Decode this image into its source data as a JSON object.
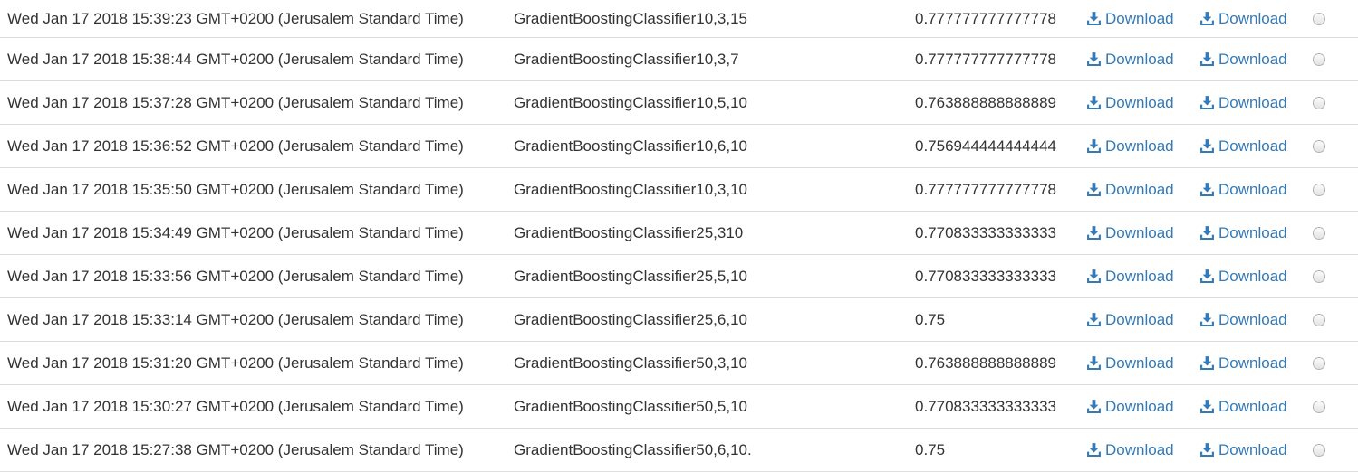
{
  "rows": [
    {
      "date": "Wed Jan 17 2018 15:39:23 GMT+0200 (Jerusalem Standard Time)",
      "model": "GradientBoostingClassifier10,3,15",
      "score": "0.777777777777778",
      "download_1": "Download",
      "download_2": "Download"
    },
    {
      "date": "Wed Jan 17 2018 15:38:44 GMT+0200 (Jerusalem Standard Time)",
      "model": "GradientBoostingClassifier10,3,7",
      "score": "0.777777777777778",
      "download_1": "Download",
      "download_2": "Download"
    },
    {
      "date": "Wed Jan 17 2018 15:37:28 GMT+0200 (Jerusalem Standard Time)",
      "model": "GradientBoostingClassifier10,5,10",
      "score": "0.763888888888889",
      "download_1": "Download",
      "download_2": "Download"
    },
    {
      "date": "Wed Jan 17 2018 15:36:52 GMT+0200 (Jerusalem Standard Time)",
      "model": "GradientBoostingClassifier10,6,10",
      "score": "0.756944444444444",
      "download_1": "Download",
      "download_2": "Download"
    },
    {
      "date": "Wed Jan 17 2018 15:35:50 GMT+0200 (Jerusalem Standard Time)",
      "model": "GradientBoostingClassifier10,3,10",
      "score": "0.777777777777778",
      "download_1": "Download",
      "download_2": "Download"
    },
    {
      "date": "Wed Jan 17 2018 15:34:49 GMT+0200 (Jerusalem Standard Time)",
      "model": "GradientBoostingClassifier25,310",
      "score": "0.770833333333333",
      "download_1": "Download",
      "download_2": "Download"
    },
    {
      "date": "Wed Jan 17 2018 15:33:56 GMT+0200 (Jerusalem Standard Time)",
      "model": "GradientBoostingClassifier25,5,10",
      "score": "0.770833333333333",
      "download_1": "Download",
      "download_2": "Download"
    },
    {
      "date": "Wed Jan 17 2018 15:33:14 GMT+0200 (Jerusalem Standard Time)",
      "model": "GradientBoostingClassifier25,6,10",
      "score": "0.75",
      "download_1": "Download",
      "download_2": "Download"
    },
    {
      "date": "Wed Jan 17 2018 15:31:20 GMT+0200 (Jerusalem Standard Time)",
      "model": "GradientBoostingClassifier50,3,10",
      "score": "0.763888888888889",
      "download_1": "Download",
      "download_2": "Download"
    },
    {
      "date": "Wed Jan 17 2018 15:30:27 GMT+0200 (Jerusalem Standard Time)",
      "model": "GradientBoostingClassifier50,5,10",
      "score": "0.770833333333333",
      "download_1": "Download",
      "download_2": "Download"
    },
    {
      "date": "Wed Jan 17 2018 15:27:38 GMT+0200 (Jerusalem Standard Time)",
      "model": "GradientBoostingClassifier50,6,10.",
      "score": "0.75",
      "download_1": "Download",
      "download_2": "Download"
    }
  ],
  "icons": {
    "download": "download-icon",
    "select": "radio-button"
  },
  "colors": {
    "link": "#337ab7",
    "text": "#333333",
    "row_border": "#dddddd"
  }
}
